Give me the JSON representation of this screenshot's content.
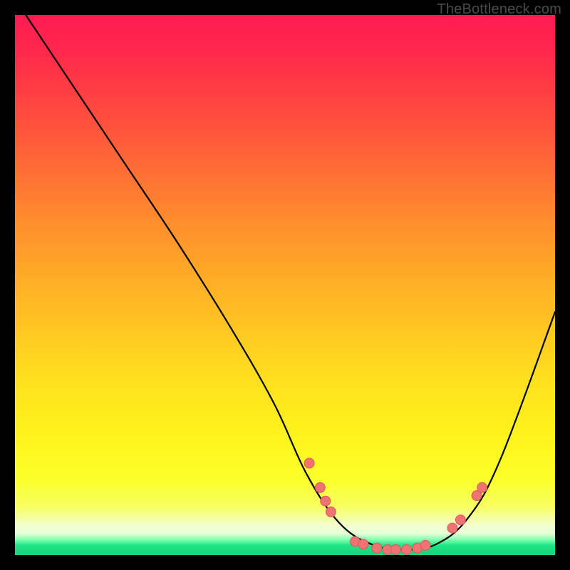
{
  "watermark": "TheBottleneck.com",
  "chart_data": {
    "type": "line",
    "title": "",
    "xlabel": "",
    "ylabel": "",
    "xlim": [
      0,
      100
    ],
    "ylim": [
      0,
      100
    ],
    "series": [
      {
        "name": "curve",
        "x": [
          2,
          10,
          20,
          30,
          40,
          48,
          54,
          60,
          66,
          72,
          78,
          84,
          90,
          100
        ],
        "y": [
          100,
          88,
          73,
          58,
          42,
          28,
          15,
          6,
          2,
          1,
          2,
          7,
          18,
          45
        ]
      }
    ],
    "dots": [
      {
        "x": 54.5,
        "y": 17.0
      },
      {
        "x": 56.5,
        "y": 12.5
      },
      {
        "x": 57.5,
        "y": 10.0
      },
      {
        "x": 58.5,
        "y": 8.0
      },
      {
        "x": 63.0,
        "y": 2.5
      },
      {
        "x": 64.5,
        "y": 2.0
      },
      {
        "x": 67.0,
        "y": 1.3
      },
      {
        "x": 69.0,
        "y": 1.0
      },
      {
        "x": 70.5,
        "y": 1.0
      },
      {
        "x": 72.5,
        "y": 1.0
      },
      {
        "x": 74.5,
        "y": 1.3
      },
      {
        "x": 76.0,
        "y": 1.8
      },
      {
        "x": 81.0,
        "y": 5.0
      },
      {
        "x": 82.5,
        "y": 6.5
      },
      {
        "x": 85.5,
        "y": 11.0
      },
      {
        "x": 86.5,
        "y": 12.5
      }
    ],
    "gradient_note": "vertical red→orange→yellow→pale→green background"
  }
}
